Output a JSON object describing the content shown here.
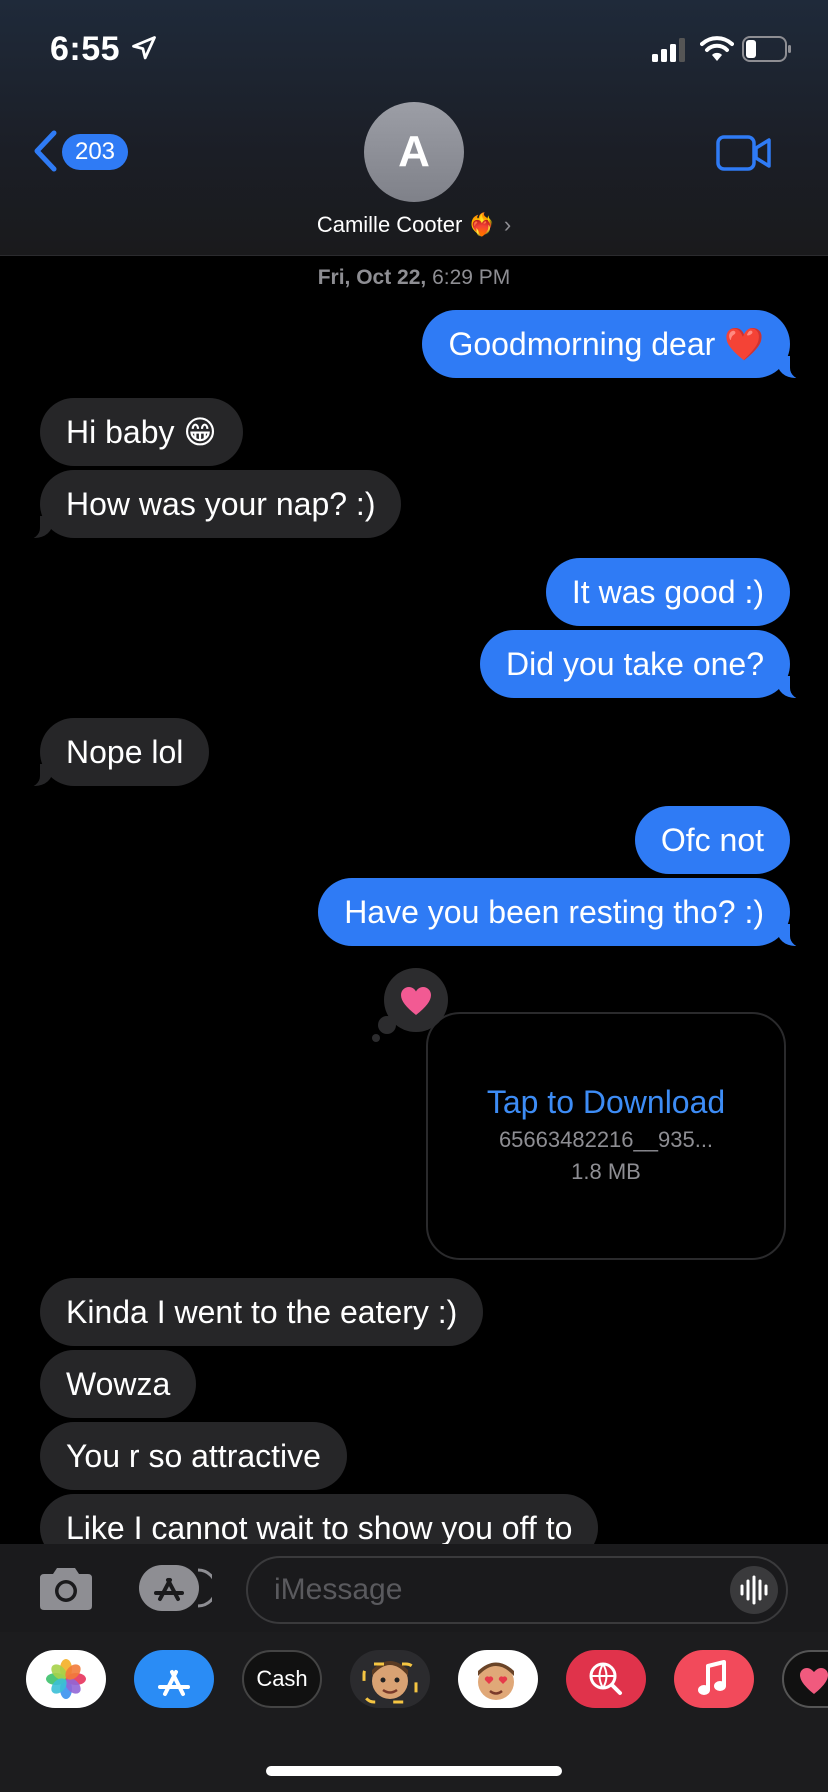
{
  "status_bar": {
    "time": "6:55"
  },
  "header": {
    "back_count": "203",
    "avatar_initial": "A",
    "contact_name": "Camille Cooter ❤️‍🔥",
    "contact_chevron": "›"
  },
  "thread": {
    "date": "Fri, Oct 22,",
    "time": "6:29 PM",
    "messages": [
      {
        "from": "me",
        "text": "Goodmorning dear ❤️"
      },
      {
        "from": "them",
        "text": "Hi baby 😁"
      },
      {
        "from": "them",
        "text": "How was your nap? :)"
      },
      {
        "from": "me",
        "text": "It was good :)"
      },
      {
        "from": "me",
        "text": "Did you take one?"
      },
      {
        "from": "them",
        "text": "Nope lol"
      },
      {
        "from": "me",
        "text": "Ofc not"
      },
      {
        "from": "me",
        "text": "Have you been resting tho? :)"
      },
      {
        "from": "them",
        "text": "Kinda I went to the eatery :)"
      },
      {
        "from": "them",
        "text": "Wowza"
      },
      {
        "from": "them",
        "text": "You r so attractive"
      },
      {
        "from": "them",
        "text": "Like I cannot wait to show you off to"
      }
    ],
    "attachment": {
      "action": "Tap to Download",
      "filename": "65663482216__935...",
      "size": "1.8 MB",
      "reaction": "heart"
    }
  },
  "composer": {
    "placeholder": "iMessage"
  },
  "app_tray": {
    "apps": [
      "photos-icon",
      "app-store-icon",
      "apple-cash-icon",
      "memoji-stickers-icon",
      "animoji-icon",
      "image-search-icon",
      "music-icon",
      "digital-touch-icon"
    ],
    "cash_label": "Cash"
  },
  "colors": {
    "outgoing": "#2f7bf5",
    "incoming": "#262628",
    "background": "#000000",
    "link": "#3d8cf5"
  }
}
